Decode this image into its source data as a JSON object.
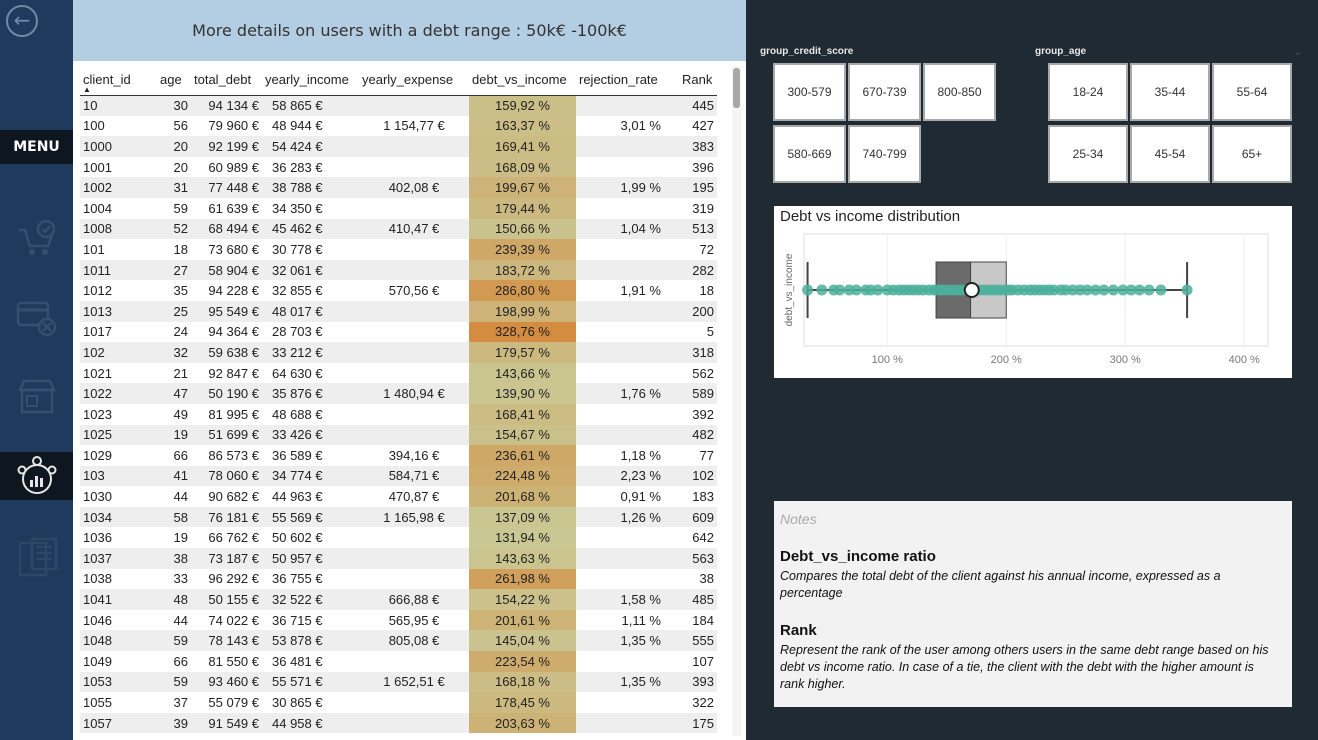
{
  "nav": {
    "back_icon": "back-arrow-icon",
    "menu_label": "MENU",
    "icons": [
      "cart-check-icon",
      "card-x-icon",
      "store-icon",
      "user-analytics-icon",
      "report-icon"
    ]
  },
  "header": {
    "title": "More details on users with a debt range : 50k€ -100k€"
  },
  "table": {
    "columns": [
      "client_id",
      "age",
      "total_debt",
      "yearly_income",
      "yearly_expense",
      "debt_vs_income",
      "rejection_rate",
      "Rank"
    ],
    "sorted_column": "client_id",
    "rows": [
      [
        "10",
        "30",
        "94 134 €",
        "58 865 €",
        "",
        "159,92 %",
        "",
        "445"
      ],
      [
        "100",
        "56",
        "79 960 €",
        "48 944 €",
        "1 154,77 €",
        "163,37 %",
        "3,01 %",
        "427"
      ],
      [
        "1000",
        "20",
        "92 199 €",
        "54 424 €",
        "",
        "169,41 %",
        "",
        "383"
      ],
      [
        "1001",
        "20",
        "60 989 €",
        "36 283 €",
        "",
        "168,09 %",
        "",
        "396"
      ],
      [
        "1002",
        "31",
        "77 448 €",
        "38 788 €",
        "402,08 €",
        "199,67 %",
        "1,99 %",
        "195"
      ],
      [
        "1004",
        "59",
        "61 639 €",
        "34 350 €",
        "",
        "179,44 %",
        "",
        "319"
      ],
      [
        "1008",
        "52",
        "68 494 €",
        "45 462 €",
        "410,47 €",
        "150,66 %",
        "1,04 %",
        "513"
      ],
      [
        "101",
        "18",
        "73 680 €",
        "30 778 €",
        "",
        "239,39 %",
        "",
        "72"
      ],
      [
        "1011",
        "27",
        "58 904 €",
        "32 061 €",
        "",
        "183,72 %",
        "",
        "282"
      ],
      [
        "1012",
        "35",
        "94 228 €",
        "32 855 €",
        "570,56 €",
        "286,80 %",
        "1,91 %",
        "18"
      ],
      [
        "1013",
        "25",
        "95 549 €",
        "48 017 €",
        "",
        "198,99 %",
        "",
        "200"
      ],
      [
        "1017",
        "24",
        "94 364 €",
        "28 703 €",
        "",
        "328,76 %",
        "",
        "5"
      ],
      [
        "102",
        "32",
        "59 638 €",
        "33 212 €",
        "",
        "179,57 %",
        "",
        "318"
      ],
      [
        "1021",
        "21",
        "92 847 €",
        "64 630 €",
        "",
        "143,66 %",
        "",
        "562"
      ],
      [
        "1022",
        "47",
        "50 190 €",
        "35 876 €",
        "1 480,94 €",
        "139,90 %",
        "1,76 %",
        "589"
      ],
      [
        "1023",
        "49",
        "81 995 €",
        "48 688 €",
        "",
        "168,41 %",
        "",
        "392"
      ],
      [
        "1025",
        "19",
        "51 699 €",
        "33 426 €",
        "",
        "154,67 %",
        "",
        "482"
      ],
      [
        "1029",
        "66",
        "86 573 €",
        "36 589 €",
        "394,16 €",
        "236,61 %",
        "1,18 %",
        "77"
      ],
      [
        "103",
        "41",
        "78 060 €",
        "34 774 €",
        "584,71 €",
        "224,48 %",
        "2,23 %",
        "102"
      ],
      [
        "1030",
        "44",
        "90 682 €",
        "44 963 €",
        "470,87 €",
        "201,68 %",
        "0,91 %",
        "183"
      ],
      [
        "1034",
        "58",
        "76 181 €",
        "55 569 €",
        "1 165,98 €",
        "137,09 %",
        "1,26 %",
        "609"
      ],
      [
        "1036",
        "19",
        "66 762 €",
        "50 602 €",
        "",
        "131,94 %",
        "",
        "642"
      ],
      [
        "1037",
        "38",
        "73 187 €",
        "50 957 €",
        "",
        "143,63 %",
        "",
        "563"
      ],
      [
        "1038",
        "33",
        "96 292 €",
        "36 755 €",
        "",
        "261,98 %",
        "",
        "38"
      ],
      [
        "1041",
        "48",
        "50 155 €",
        "32 522 €",
        "666,88 €",
        "154,22 %",
        "1,58 %",
        "485"
      ],
      [
        "1046",
        "44",
        "74 022 €",
        "36 715 €",
        "565,95 €",
        "201,61 %",
        "1,11 %",
        "184"
      ],
      [
        "1048",
        "59",
        "78 143 €",
        "53 878 €",
        "805,08 €",
        "145,04 %",
        "1,35 %",
        "555"
      ],
      [
        "1049",
        "66",
        "81 550 €",
        "36 481 €",
        "",
        "223,54 %",
        "",
        "107"
      ],
      [
        "1053",
        "59",
        "93 460 €",
        "55 571 €",
        "1 652,51 €",
        "168,18 %",
        "1,35 %",
        "393"
      ],
      [
        "1055",
        "37",
        "55 079 €",
        "30 865 €",
        "",
        "178,45 %",
        "",
        "322"
      ],
      [
        "1057",
        "39",
        "91 549 €",
        "44 958 €",
        "",
        "203,63 %",
        "",
        "175"
      ]
    ],
    "heat_colors": {
      "low": "#c9c895",
      "mid": "#b9ad6a",
      "high": "#c98a3e",
      "max": "#d48c3f"
    }
  },
  "slicers": {
    "credit": {
      "title": "group_credit_score",
      "options": [
        "300-579",
        "670-739",
        "800-850",
        "580-669",
        "740-799"
      ]
    },
    "age": {
      "title": "group_age",
      "options": [
        "18-24",
        "35-44",
        "55-64",
        "25-34",
        "45-54",
        "65+"
      ]
    }
  },
  "chart": {
    "title": "Debt vs income distribution",
    "ylabel": "debt_vs_income"
  },
  "chart_data": {
    "type": "box",
    "title": "Debt vs income distribution",
    "ylabel": "debt_vs_income",
    "x_ticks": [
      "100 %",
      "200 %",
      "300 %",
      "400 %"
    ],
    "xlim": [
      30,
      420
    ],
    "whisker_min": 33,
    "q1": 141,
    "median": 170,
    "q3": 200,
    "whisker_max": 352,
    "point_color": "#4bb09a",
    "points": [
      33,
      45,
      55,
      60,
      68,
      74,
      82,
      86,
      92,
      100,
      105,
      110,
      114,
      118,
      122,
      126,
      130,
      135,
      139,
      143,
      146,
      150,
      154,
      158,
      162,
      166,
      170,
      174,
      178,
      182,
      186,
      190,
      194,
      198,
      202,
      205,
      210,
      215,
      220,
      224,
      228,
      232,
      236,
      240,
      246,
      250,
      256,
      262,
      268,
      275,
      282,
      290,
      298,
      305,
      312,
      320,
      330,
      352
    ]
  },
  "notes": {
    "placeholder": "Notes",
    "h1": "Debt_vs_income ratio",
    "p1": "Compares the total debt of the client against his annual income, expressed as a percentage",
    "h2": "Rank",
    "p2": "Represent the rank of the user among others users in the same debt range based on his debt vs income ratio. In case of a tie, the client with the debt with the higher amount is rank higher."
  }
}
